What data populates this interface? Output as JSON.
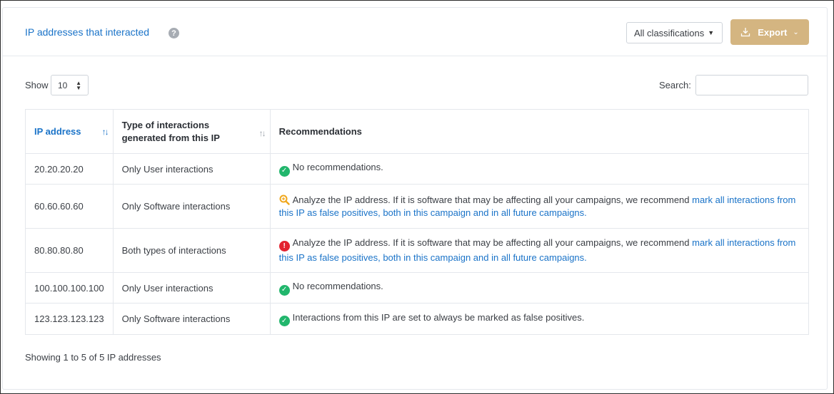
{
  "header": {
    "title": "IP addresses that interacted",
    "help_symbol": "?",
    "classification_select": "All classifications",
    "export_label": "Export"
  },
  "controls": {
    "show_label": "Show",
    "show_value": "10",
    "search_label": "Search:"
  },
  "table": {
    "columns": [
      "IP address",
      "Type of interactions generated from this IP",
      "Recommendations"
    ],
    "rows": [
      {
        "ip": "20.20.20.20",
        "type": "Only User interactions",
        "icon": "check-icon",
        "text": "No recommendations.",
        "link": ""
      },
      {
        "ip": "60.60.60.60",
        "type": "Only Software interactions",
        "icon": "magnify-icon",
        "text": "Analyze the IP address. If it is software that may be affecting all your campaigns, we recommend ",
        "link": "mark all interactions from this IP as false positives, both in this campaign and in all future campaigns."
      },
      {
        "ip": "80.80.80.80",
        "type": "Both types of interactions",
        "icon": "alert-icon",
        "text": "Analyze the IP address. If it is software that may be affecting all your campaigns, we recommend ",
        "link": "mark all interactions from this IP as false positives, both in this campaign and in all future campaigns."
      },
      {
        "ip": "100.100.100.100",
        "type": "Only User interactions",
        "icon": "check-icon",
        "text": "No recommendations.",
        "link": ""
      },
      {
        "ip": "123.123.123.123",
        "type": "Only Software interactions",
        "icon": "check-icon",
        "text": "Interactions from this IP are set to always be marked as false positives.",
        "link": ""
      }
    ]
  },
  "footer": {
    "info": "Showing 1 to 5 of 5 IP addresses"
  },
  "colors": {
    "accent": "#1a73c8",
    "export_bg": "#d4b581",
    "ok": "#21b66c",
    "alert": "#e3222f",
    "magnify": "#f0a71c"
  }
}
